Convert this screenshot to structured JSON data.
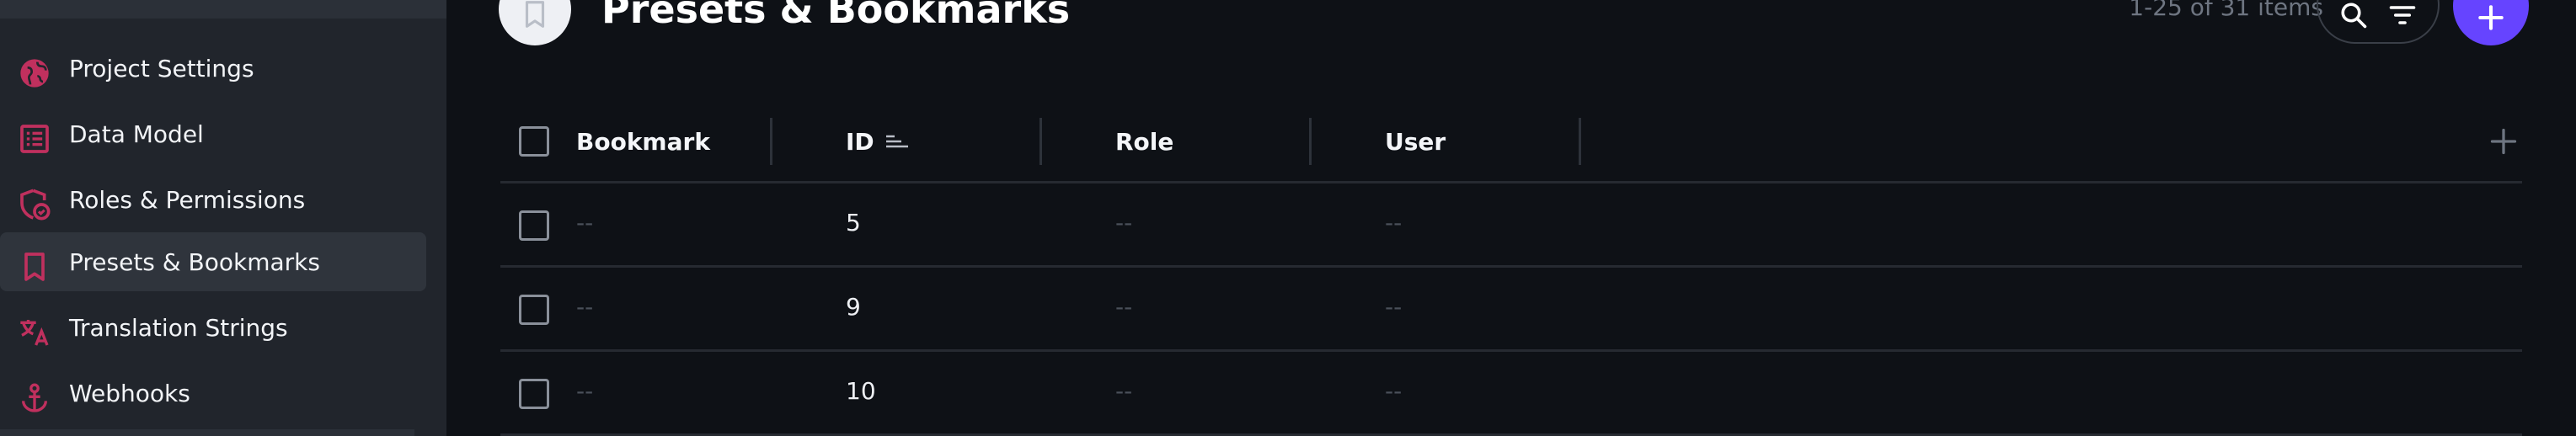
{
  "sidebar": {
    "items": [
      {
        "label": "Project Settings",
        "icon": "globe-icon"
      },
      {
        "label": "Data Model",
        "icon": "list-box-icon"
      },
      {
        "label": "Roles & Permissions",
        "icon": "shield-badge-icon"
      },
      {
        "label": "Presets & Bookmarks",
        "icon": "bookmark-icon",
        "active": true
      },
      {
        "label": "Translation Strings",
        "icon": "translate-icon"
      },
      {
        "label": "Webhooks",
        "icon": "anchor-icon"
      }
    ]
  },
  "header": {
    "title": "Presets & Bookmarks",
    "title_icon": "bookmark-icon",
    "items_count": "1-25 of 31 items"
  },
  "colors": {
    "accent": "#6644ff",
    "icon_pink": "#c0305e",
    "sidebar_bg": "#21252c",
    "main_bg": "#0e1116"
  },
  "table": {
    "columns": [
      {
        "label": "Bookmark"
      },
      {
        "label": "ID",
        "sorted": true
      },
      {
        "label": "Role"
      },
      {
        "label": "User"
      }
    ],
    "rows": [
      {
        "bookmark": "--",
        "id": "5",
        "role": "--",
        "user": "--"
      },
      {
        "bookmark": "--",
        "id": "9",
        "role": "--",
        "user": "--"
      },
      {
        "bookmark": "--",
        "id": "10",
        "role": "--",
        "user": "--"
      }
    ]
  }
}
